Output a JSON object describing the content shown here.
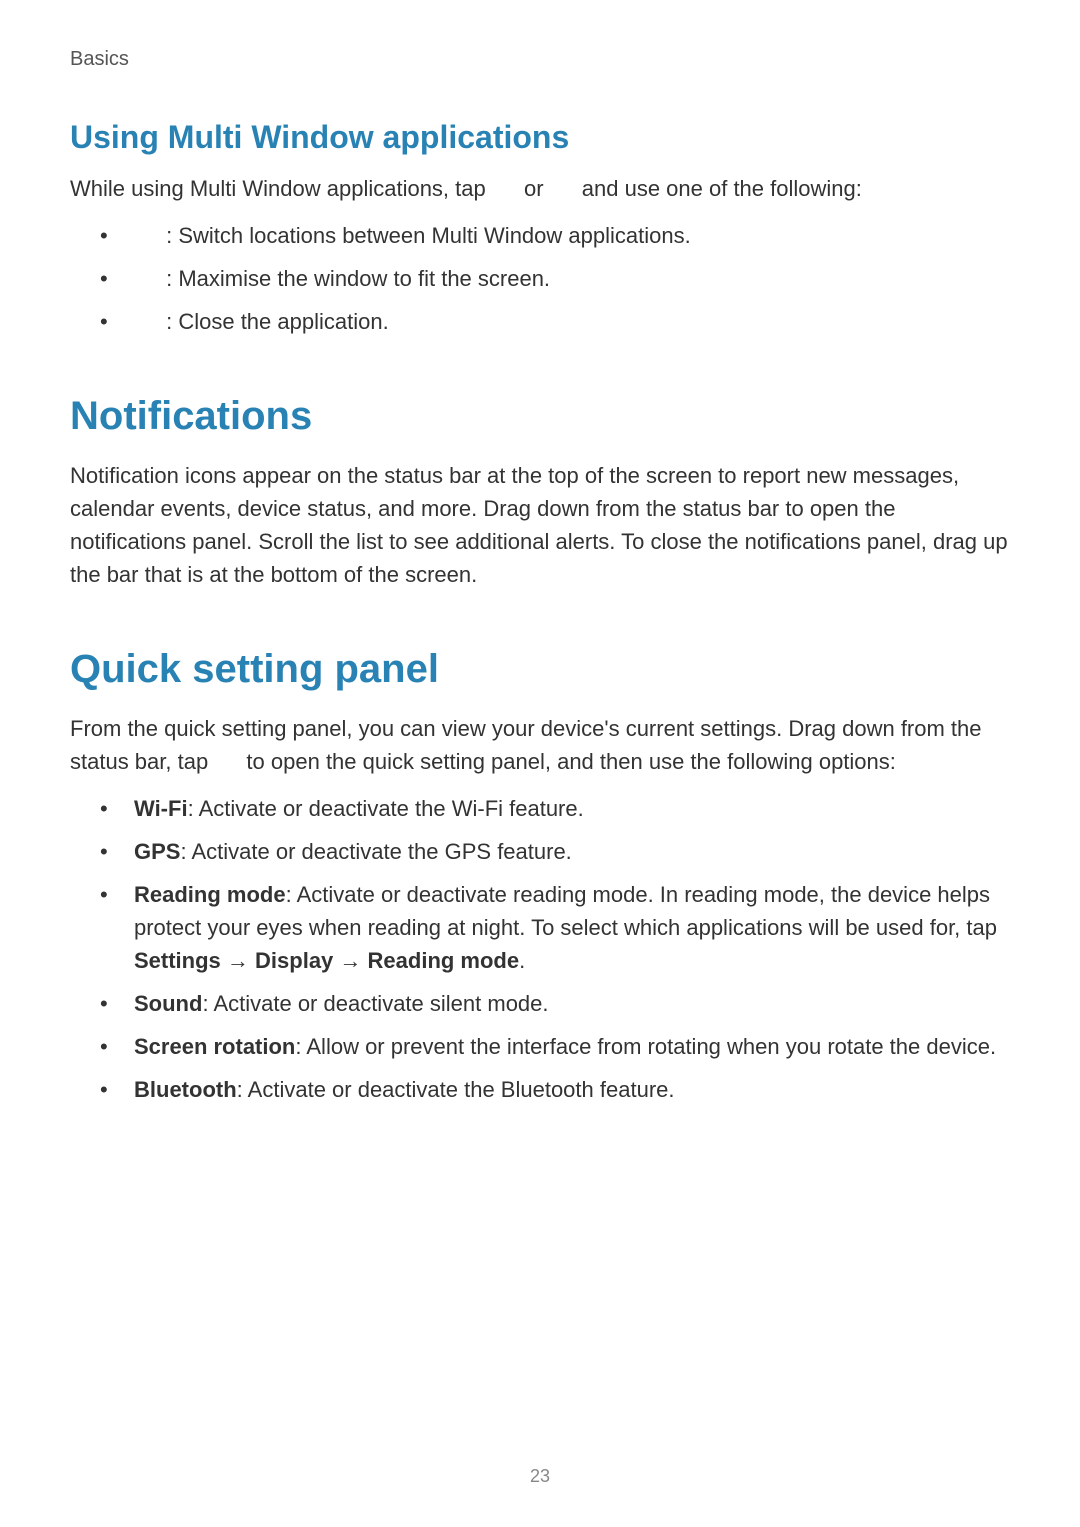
{
  "header": {
    "chapter": "Basics"
  },
  "section1": {
    "heading": "Using Multi Window applications",
    "intro_pre": "While using Multi Window applications, tap ",
    "intro_mid": " or ",
    "intro_post": " and use one of the following:",
    "items": [
      " : Switch locations between Multi Window applications.",
      " : Maximise the window to fit the screen.",
      " : Close the application."
    ]
  },
  "section2": {
    "heading": "Notifications",
    "paragraph": "Notification icons appear on the status bar at the top of the screen to report new messages, calendar events, device status, and more. Drag down from the status bar to open the notifications panel. Scroll the list to see additional alerts. To close the notifications panel, drag up the bar that is at the bottom of the screen."
  },
  "section3": {
    "heading": "Quick setting panel",
    "intro_pre": "From the quick setting panel, you can view your device's current settings. Drag down from the status bar, tap ",
    "intro_post": " to open the quick setting panel, and then use the following options:",
    "items": [
      {
        "term": "Wi-Fi",
        "desc": ": Activate or deactivate the Wi-Fi feature."
      },
      {
        "term": "GPS",
        "desc": ": Activate or deactivate the GPS feature."
      },
      {
        "term": "Reading mode",
        "desc": ": Activate or deactivate reading mode. In reading mode, the device helps protect your eyes when reading at night. To select which applications will be used for, tap ",
        "path0": "Settings",
        "arrow": " → ",
        "path1": "Display",
        "path2": "Reading mode",
        "tail": "."
      },
      {
        "term": "Sound",
        "desc": ": Activate or deactivate silent mode."
      },
      {
        "term": "Screen rotation",
        "desc": ": Allow or prevent the interface from rotating when you rotate the device."
      },
      {
        "term": "Bluetooth",
        "desc": ": Activate or deactivate the Bluetooth feature."
      }
    ]
  },
  "footer": {
    "page_number": "23"
  }
}
